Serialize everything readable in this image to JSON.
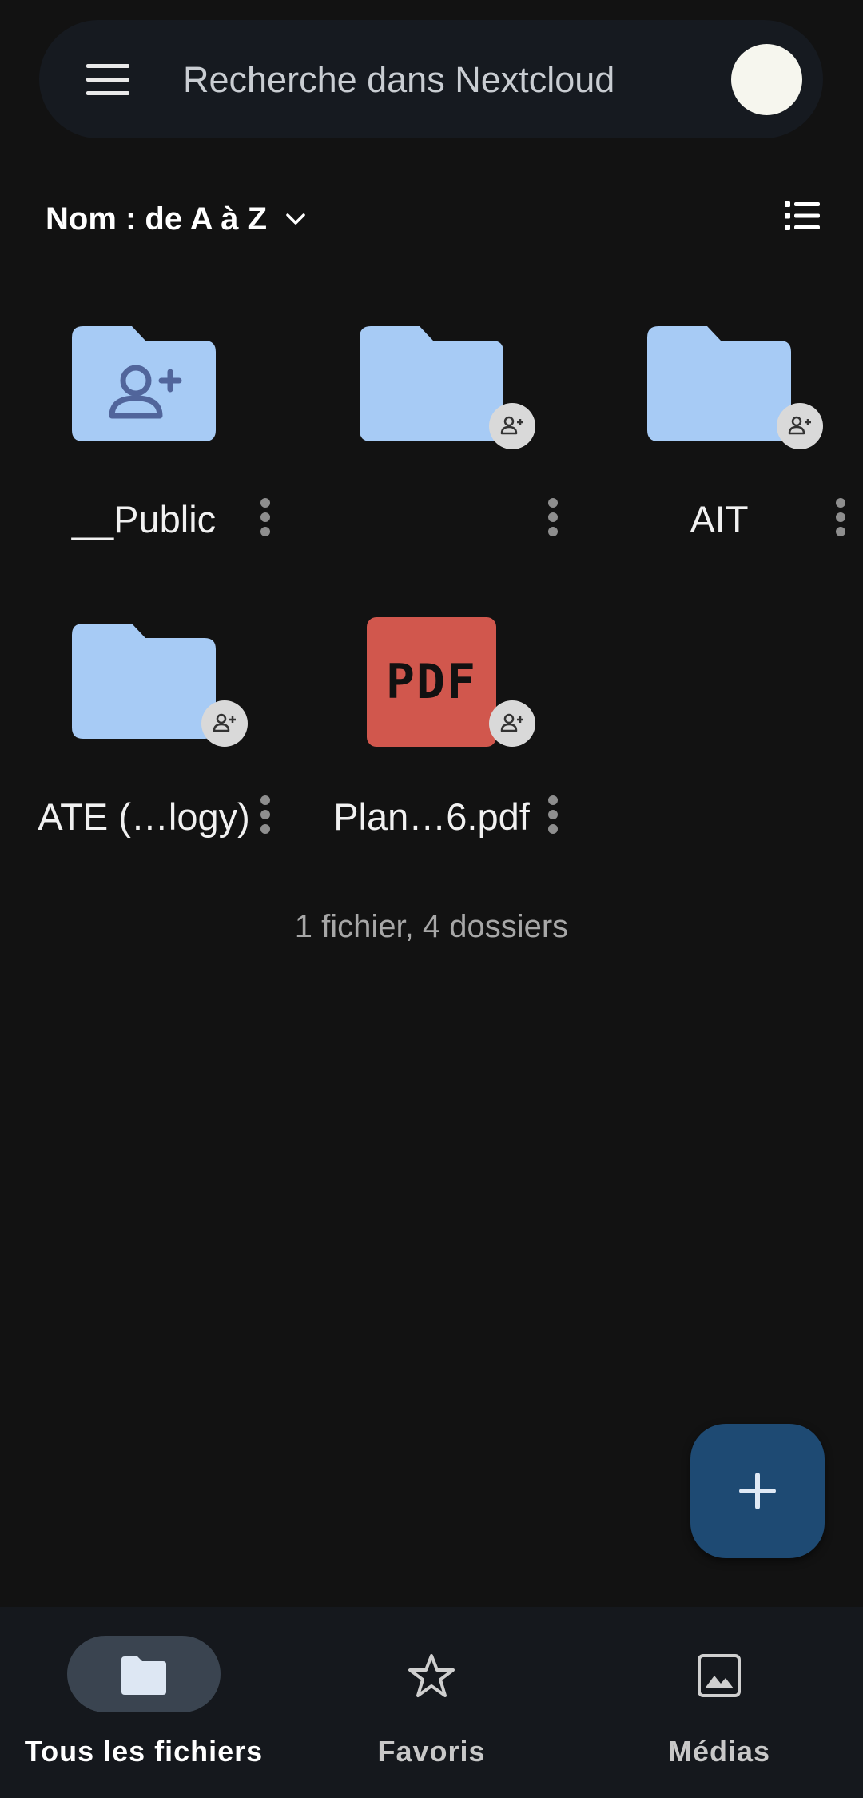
{
  "search": {
    "placeholder": "Recherche dans Nextcloud"
  },
  "sort": {
    "label": "Nom : de A à Z"
  },
  "files": [
    {
      "name": "__Public",
      "type": "shared-folder"
    },
    {
      "name": "",
      "type": "folder",
      "shared": true
    },
    {
      "name": "AIT",
      "type": "folder",
      "shared": true
    },
    {
      "name": "ATE (…logy)",
      "type": "folder",
      "shared": true
    },
    {
      "name": "Plan…6.pdf",
      "type": "pdf",
      "shared": true,
      "thumb_text": "PDF"
    }
  ],
  "summary": "1 fichier, 4 dossiers",
  "bottom_nav": {
    "all_files": "Tous les fichiers",
    "favorites": "Favoris",
    "media": "Médias"
  },
  "colors": {
    "background": "#121212",
    "folder": "#a7cbf5",
    "pdf": "#d1574d",
    "fab": "#1e4a73"
  }
}
